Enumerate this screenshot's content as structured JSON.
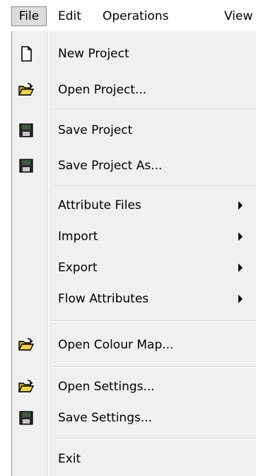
{
  "menubar": {
    "file": "File",
    "edit": "Edit",
    "operations": "Operations",
    "view": "View"
  },
  "menu": {
    "new_project": "New Project",
    "open_project": "Open Project...",
    "save_project": "Save Project",
    "save_project_as": "Save Project As...",
    "attribute_files": "Attribute Files",
    "import": "Import",
    "export": "Export",
    "flow_attributes": "Flow Attributes",
    "open_colour_map": "Open Colour Map...",
    "open_settings": "Open Settings...",
    "save_settings": "Save Settings...",
    "exit": "Exit"
  },
  "icons": {
    "new_project": "new-document-icon",
    "open_project": "open-folder-icon",
    "save_project": "floppy-disk-icon",
    "save_project_as": "floppy-disk-icon",
    "open_colour_map": "open-folder-icon",
    "open_settings": "open-folder-icon",
    "save_settings": "floppy-disk-icon"
  },
  "colors": {
    "menu_background": "#f0f0f0",
    "folder": "#d8b020",
    "floppy": "#2a2a2a"
  }
}
